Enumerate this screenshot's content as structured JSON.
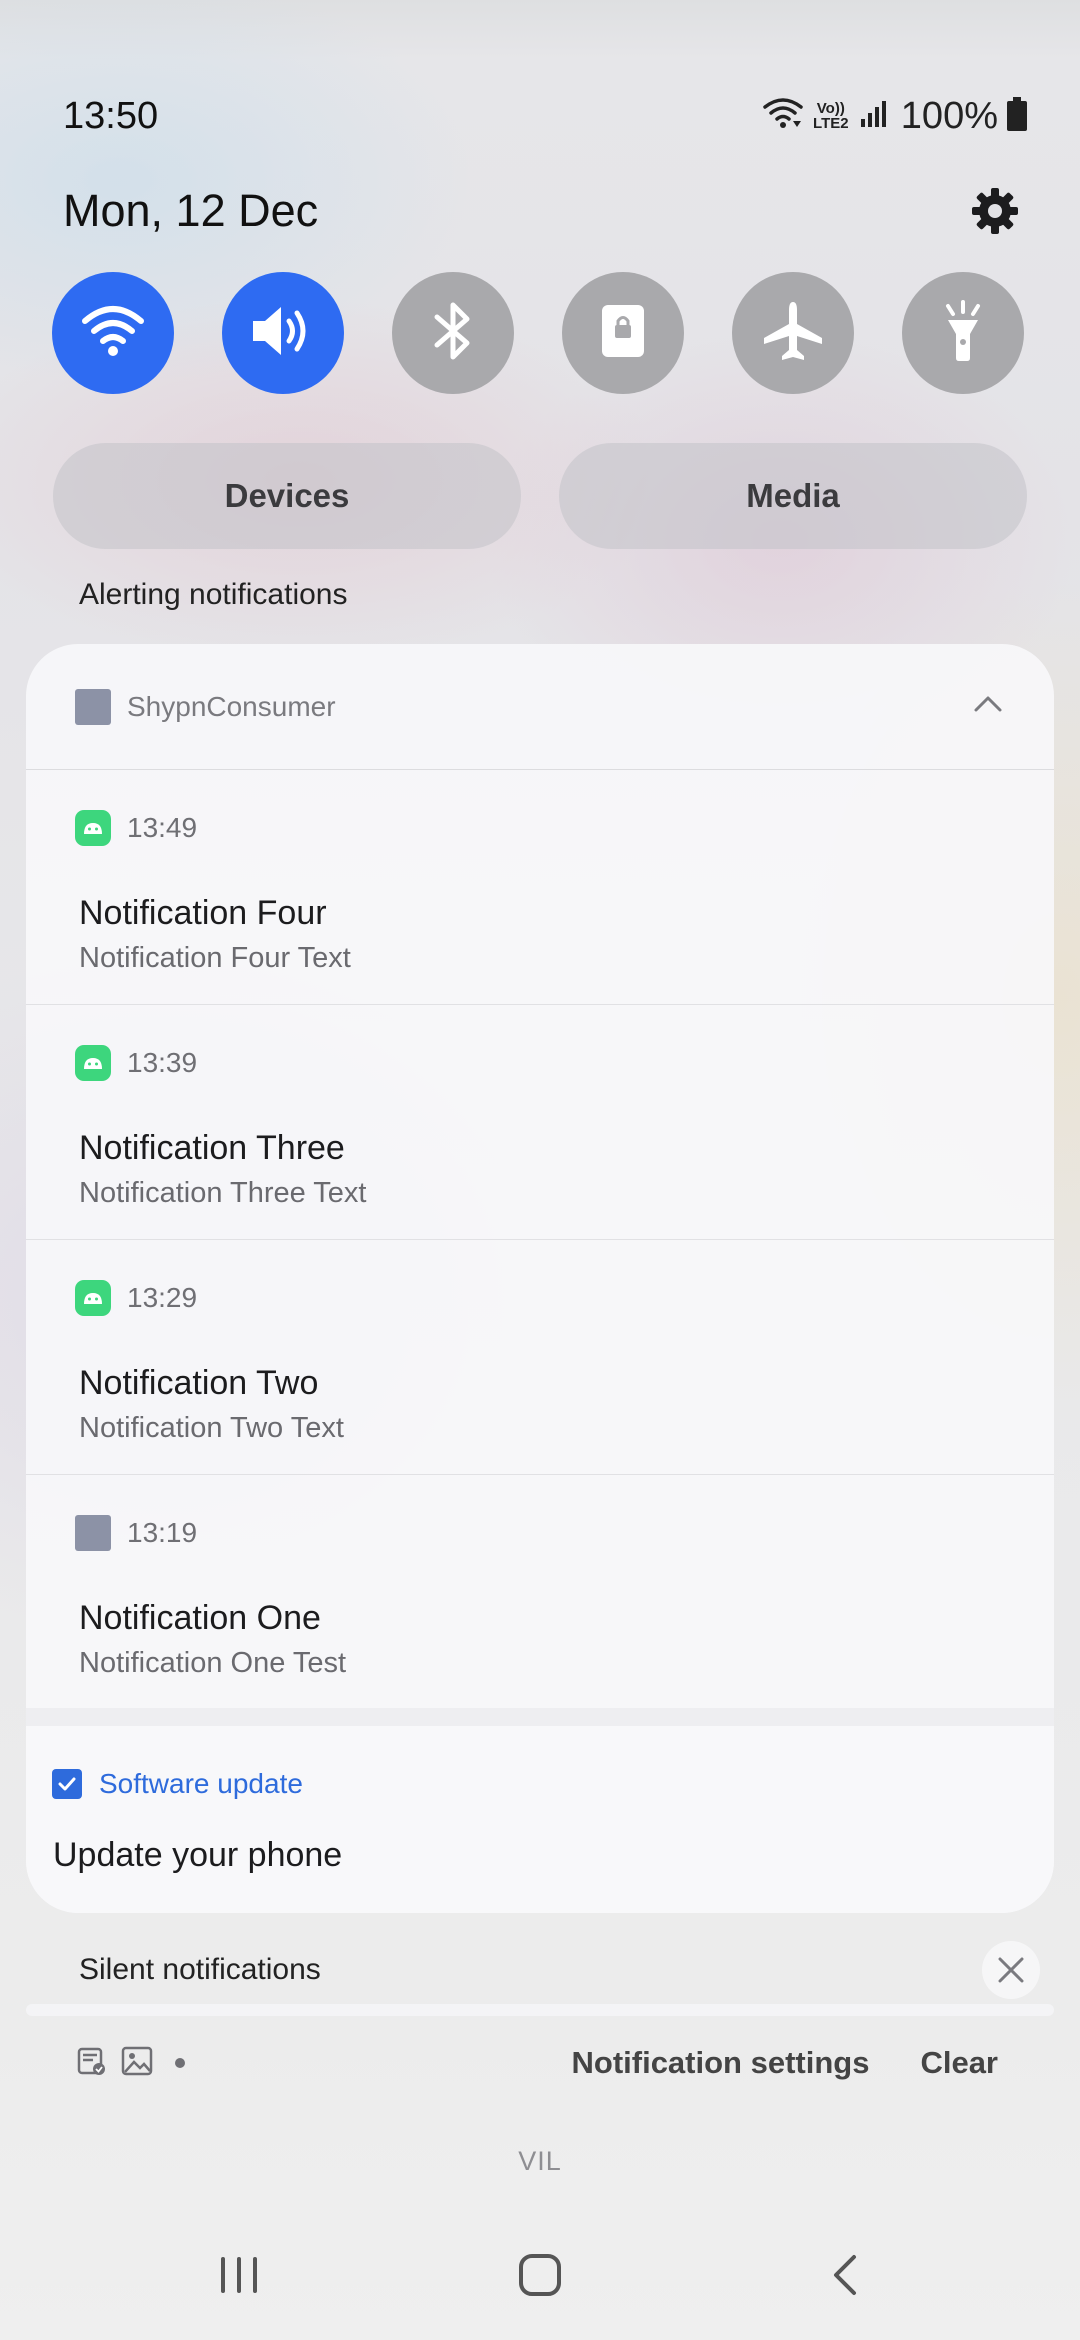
{
  "status_bar": {
    "time": "13:50",
    "network_label": "Vo)) LTE2",
    "battery": "100%"
  },
  "header": {
    "date": "Mon, 12 Dec",
    "settings_icon": "gear-icon"
  },
  "quick_toggles": [
    {
      "name": "wifi",
      "icon": "wifi-icon",
      "on": true
    },
    {
      "name": "sound",
      "icon": "volume-icon",
      "on": true
    },
    {
      "name": "bluetooth",
      "icon": "bluetooth-icon",
      "on": false
    },
    {
      "name": "rotation-lock",
      "icon": "lock-icon",
      "on": false
    },
    {
      "name": "airplane-mode",
      "icon": "airplane-icon",
      "on": false
    },
    {
      "name": "flashlight",
      "icon": "flashlight-icon",
      "on": false
    }
  ],
  "pills": {
    "devices": "Devices",
    "media": "Media"
  },
  "alerting": {
    "label": "Alerting notifications",
    "group": {
      "app_name": "ShypnConsumer",
      "notifications": [
        {
          "time": "13:49",
          "title": "Notification Four",
          "text": "Notification Four Text",
          "icon": "android-icon"
        },
        {
          "time": "13:39",
          "title": "Notification Three",
          "text": "Notification Three Text",
          "icon": "android-icon"
        },
        {
          "time": "13:29",
          "title": "Notification Two",
          "text": "Notification Two Text",
          "icon": "android-icon"
        },
        {
          "time": "13:19",
          "title": "Notification One",
          "text": "Notification One Test",
          "icon": "app-square-icon"
        }
      ]
    },
    "software_update": {
      "app_name": "Software update",
      "title": "Update your phone"
    }
  },
  "silent": {
    "label": "Silent notifications"
  },
  "footer": {
    "notification_settings": "Notification settings",
    "clear": "Clear"
  },
  "carrier": "VIL",
  "colors": {
    "accent_blue": "#2E6BF2",
    "android_green": "#3DD67D",
    "link_blue": "#2E6BDC"
  }
}
